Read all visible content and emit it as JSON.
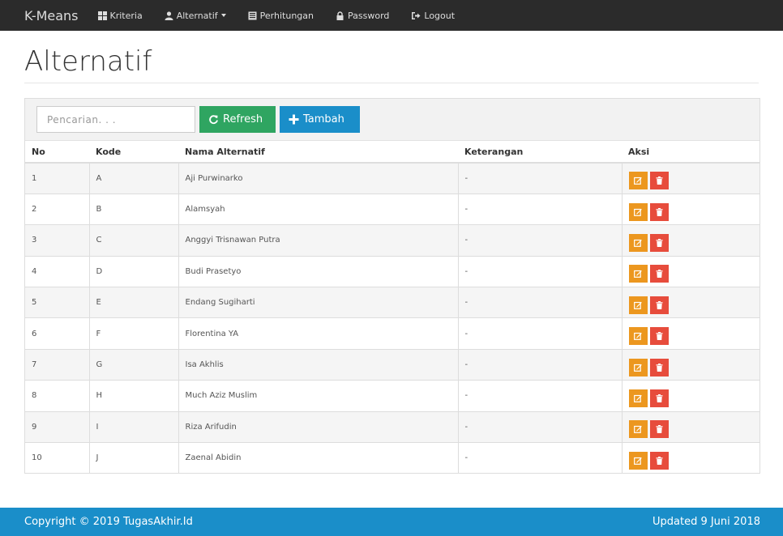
{
  "nav": {
    "brand": "K-Means",
    "items": [
      {
        "label": "Kriteria",
        "icon": "grid-icon"
      },
      {
        "label": "Alternatif",
        "icon": "user-icon",
        "dropdown": true
      },
      {
        "label": "Perhitungan",
        "icon": "calculator-icon"
      },
      {
        "label": "Password",
        "icon": "lock-icon"
      },
      {
        "label": "Logout",
        "icon": "logout-icon"
      }
    ]
  },
  "page": {
    "title": "Alternatif"
  },
  "toolbar": {
    "search_placeholder": "Pencarian. . .",
    "refresh_label": "Refresh",
    "add_label": "Tambah"
  },
  "table": {
    "headers": [
      "No",
      "Kode",
      "Nama Alternatif",
      "Keterangan",
      "Aksi"
    ],
    "rows": [
      [
        "1",
        "A",
        "Aji Purwinarko",
        "-"
      ],
      [
        "2",
        "B",
        "Alamsyah",
        "-"
      ],
      [
        "3",
        "C",
        "Anggyi Trisnawan Putra",
        "-"
      ],
      [
        "4",
        "D",
        "Budi Prasetyo",
        "-"
      ],
      [
        "5",
        "E",
        "Endang Sugiharti",
        "-"
      ],
      [
        "6",
        "F",
        "Florentina YA",
        "-"
      ],
      [
        "7",
        "G",
        "Isa Akhlis",
        "-"
      ],
      [
        "8",
        "H",
        "Much Aziz Muslim",
        "-"
      ],
      [
        "9",
        "I",
        "Riza Arifudin",
        "-"
      ],
      [
        "10",
        "J",
        "Zaenal Abidin",
        "-"
      ]
    ]
  },
  "footer": {
    "copyright": "Copyright © 2019 TugasAkhir.Id",
    "updated": "Updated 9 Juni 2018"
  },
  "colors": {
    "navbar": "#2b2b2b",
    "refresh": "#2fa561",
    "primary": "#1a8ec9",
    "edit": "#ec971f",
    "delete": "#e74c3c"
  }
}
